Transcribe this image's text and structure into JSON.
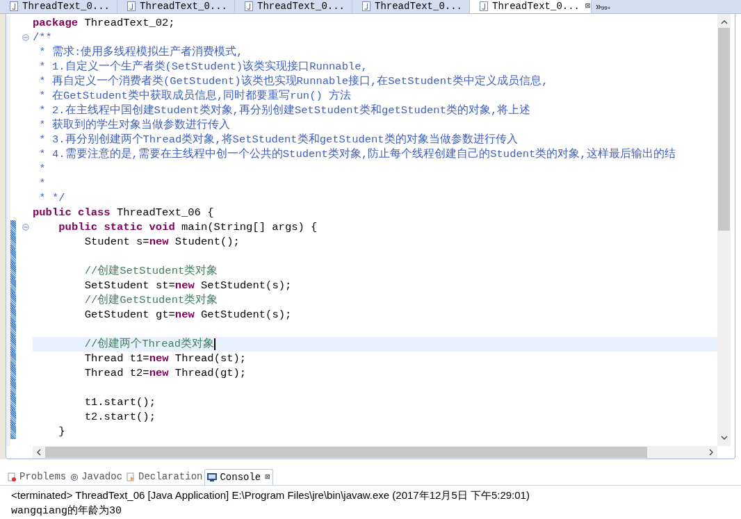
{
  "editor_tabs": [
    {
      "label": "ThreadText_0...",
      "selected": false
    },
    {
      "label": "ThreadText_0...",
      "selected": false
    },
    {
      "label": "ThreadText_0...",
      "selected": false
    },
    {
      "label": "ThreadText_0...",
      "selected": false
    },
    {
      "label": "ThreadText_0...",
      "selected": true,
      "close": "⊠"
    }
  ],
  "tab_overflow": {
    "arrow": "»",
    "count": "99+"
  },
  "code_lines": [
    {
      "kind": "code",
      "tokens": [
        {
          "kind": "keyword",
          "text": "package"
        },
        {
          "kind": "plain",
          "text": " ThreadText_02;"
        }
      ]
    },
    {
      "kind": "code",
      "foldable": true,
      "tokens": [
        {
          "kind": "javadoc",
          "text": "/**"
        }
      ]
    },
    {
      "kind": "code",
      "tokens": [
        {
          "kind": "javadoc",
          "text": " * 需求:使用多线程模拟生产者消费模式,"
        }
      ]
    },
    {
      "kind": "code",
      "tokens": [
        {
          "kind": "javadoc",
          "text": " * 1.自定义一个生产者类(SetStudent)该类实现接口Runnable,"
        }
      ]
    },
    {
      "kind": "code",
      "tokens": [
        {
          "kind": "javadoc",
          "text": " * 再自定义一个消费者类(GetStudent)该类也实现Runnable接口,在SetStudent类中定义成员信息,"
        }
      ]
    },
    {
      "kind": "code",
      "tokens": [
        {
          "kind": "javadoc",
          "text": " * 在GetStudent类中获取成员信息,同时都要重写run() 方法"
        }
      ]
    },
    {
      "kind": "code",
      "tokens": [
        {
          "kind": "javadoc",
          "text": " * 2.在主线程中国创建Student类对象,再分别创建SetStudent类和getStudent类的对象,将上述"
        }
      ]
    },
    {
      "kind": "code",
      "tokens": [
        {
          "kind": "javadoc",
          "text": " * 获取到的学生对象当做参数进行传入"
        }
      ]
    },
    {
      "kind": "code",
      "tokens": [
        {
          "kind": "javadoc",
          "text": " * 3.再分别创建两个Thread类对象,将SetStudent类和getStudent类的对象当做参数进行传入"
        }
      ]
    },
    {
      "kind": "code",
      "tokens": [
        {
          "kind": "javadoc",
          "text": " * 4.需要注意的是,需要在主线程中创一个公共的Student类对象,防止每个线程创建自己的Student类的对象,这样最后输出的结"
        }
      ]
    },
    {
      "kind": "code",
      "tokens": [
        {
          "kind": "javadoc",
          "text": " *"
        }
      ]
    },
    {
      "kind": "code",
      "tokens": [
        {
          "kind": "javadoc",
          "text": " *"
        }
      ]
    },
    {
      "kind": "code",
      "tokens": [
        {
          "kind": "javadoc",
          "text": " * */"
        }
      ]
    },
    {
      "kind": "code",
      "tokens": [
        {
          "kind": "keyword",
          "text": "public class"
        },
        {
          "kind": "plain",
          "text": " ThreadText_06 {"
        }
      ],
      "children": [
        {
          "kind": "code",
          "foldable": true,
          "changed": true,
          "tokens": [
            {
              "kind": "keyword",
              "text": "public static void"
            },
            {
              "kind": "plain",
              "text": " main(String[] args) {"
            }
          ],
          "children": [
            {
              "kind": "code",
              "changed": true,
              "tokens": [
                {
                  "kind": "plain",
                  "text": "Student s="
                },
                {
                  "kind": "keyword",
                  "text": "new"
                },
                {
                  "kind": "plain",
                  "text": " Student();"
                }
              ]
            },
            {
              "kind": "blank",
              "changed": true
            },
            {
              "kind": "code",
              "changed": true,
              "tokens": [
                {
                  "kind": "comment",
                  "text": "//创建SetStudent类对象"
                }
              ]
            },
            {
              "kind": "code",
              "changed": true,
              "tokens": [
                {
                  "kind": "plain",
                  "text": "SetStudent st="
                },
                {
                  "kind": "keyword",
                  "text": "new"
                },
                {
                  "kind": "plain",
                  "text": " SetStudent(s);"
                }
              ]
            },
            {
              "kind": "code",
              "changed": true,
              "tokens": [
                {
                  "kind": "comment",
                  "text": "//创建GetStudent类对象"
                }
              ]
            },
            {
              "kind": "code",
              "changed": true,
              "tokens": [
                {
                  "kind": "plain",
                  "text": "GetStudent gt="
                },
                {
                  "kind": "keyword",
                  "text": "new"
                },
                {
                  "kind": "plain",
                  "text": " GetStudent(s);"
                }
              ]
            },
            {
              "kind": "blank",
              "changed": true
            },
            {
              "kind": "code",
              "changed": true,
              "current": true,
              "tokens": [
                {
                  "kind": "comment",
                  "text": "//创建两个Thread类对象"
                }
              ]
            },
            {
              "kind": "code",
              "changed": true,
              "tokens": [
                {
                  "kind": "plain",
                  "text": "Thread t1="
                },
                {
                  "kind": "keyword",
                  "text": "new"
                },
                {
                  "kind": "plain",
                  "text": " Thread(st);"
                }
              ]
            },
            {
              "kind": "code",
              "changed": true,
              "tokens": [
                {
                  "kind": "plain",
                  "text": "Thread t2="
                },
                {
                  "kind": "keyword",
                  "text": "new"
                },
                {
                  "kind": "plain",
                  "text": " Thread(gt);"
                }
              ]
            },
            {
              "kind": "blank",
              "changed": true
            },
            {
              "kind": "code",
              "changed": true,
              "tokens": [
                {
                  "kind": "plain",
                  "text": "t1.start();"
                }
              ]
            },
            {
              "kind": "code",
              "changed": true,
              "tokens": [
                {
                  "kind": "plain",
                  "text": "t2.start();"
                }
              ]
            }
          ]
        },
        {
          "kind": "code",
          "changed": true,
          "tokens": [
            {
              "kind": "plain",
              "text": "}"
            }
          ]
        }
      ]
    }
  ],
  "panel_tabs": [
    {
      "kind": "problems",
      "label": "Problems",
      "selected": false
    },
    {
      "kind": "javadoc",
      "label": "Javadoc",
      "selected": false
    },
    {
      "kind": "declaration",
      "label": "Declaration",
      "selected": false
    },
    {
      "kind": "console",
      "label": "Console",
      "selected": true,
      "close": "⊠"
    }
  ],
  "console": {
    "header": "<terminated> ThreadText_06 [Java Application] E:\\Program Files\\jre\\bin\\javaw.exe (2017年12月5日 下午5:29:01)",
    "output": [
      "wangqiang的年龄为30"
    ]
  }
}
